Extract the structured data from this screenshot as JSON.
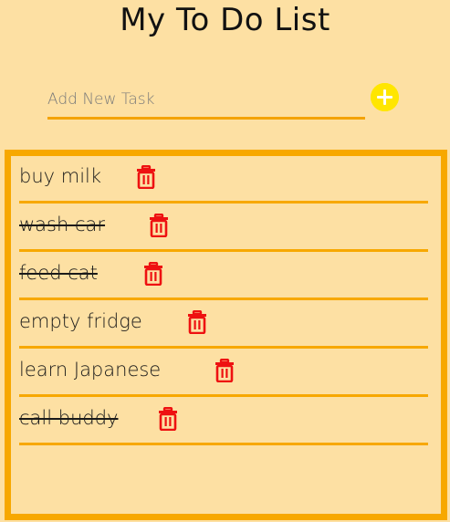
{
  "header": {
    "title": "My To Do List"
  },
  "add_task": {
    "placeholder": "Add New Task",
    "value": "",
    "button_icon": "plus-circle-icon"
  },
  "tasks": [
    {
      "text": "buy milk",
      "completed": false
    },
    {
      "text": "wash car",
      "completed": true
    },
    {
      "text": "feed cat",
      "completed": true
    },
    {
      "text": "empty fridge",
      "completed": false
    },
    {
      "text": "learn Japanese",
      "completed": false
    },
    {
      "text": "call buddy",
      "completed": true
    }
  ],
  "icons": {
    "delete": "trash-icon"
  },
  "colors": {
    "background": "#fde0a3",
    "accent": "#f7a800",
    "add_button": "#ffe600",
    "delete_icon": "#ee1111",
    "text": "#1a1a1a"
  }
}
